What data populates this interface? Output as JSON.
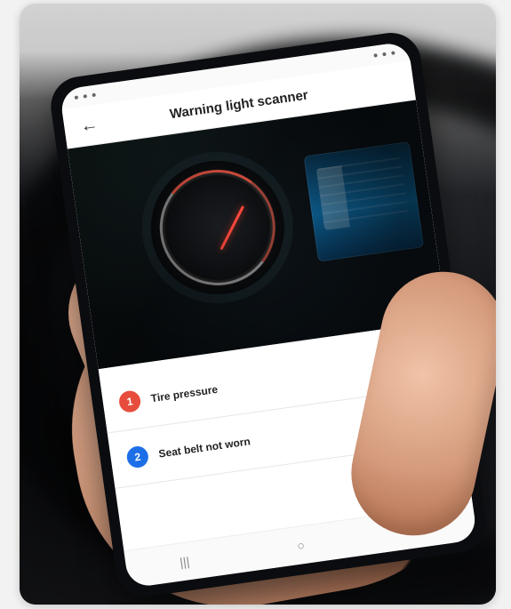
{
  "screen": {
    "title": "Warning light scanner",
    "items": [
      {
        "number": "1",
        "label": "Tire pressure",
        "badge_color": "#e74c3c",
        "action_icon": "power-icon",
        "action_color": "#0a2a22",
        "action_icon_color": "#2ecc71"
      },
      {
        "number": "2",
        "label": "Seat belt not worn",
        "badge_color": "#1e6ee8",
        "action_icon": "drop-icon",
        "action_color": "#2a0b12",
        "action_icon_color": "#ff2d55"
      }
    ]
  }
}
